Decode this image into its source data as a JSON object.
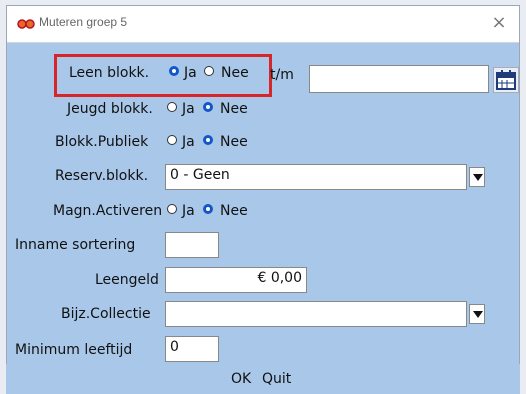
{
  "window": {
    "title": "Muteren groep 5",
    "close_glyph": "×"
  },
  "form": {
    "leen_blokk": {
      "label": "Leen blokk.",
      "options": [
        "Ja",
        "Nee"
      ],
      "selected": "Ja",
      "tm_label": "t/m",
      "tm_value": ""
    },
    "jeugd_blokk": {
      "label": "Jeugd blokk.",
      "options": [
        "Ja",
        "Nee"
      ],
      "selected": "Nee"
    },
    "blokk_publiek": {
      "label": "Blokk.Publiek",
      "options": [
        "Ja",
        "Nee"
      ],
      "selected": "Nee"
    },
    "reserv_blokk": {
      "label": "Reserv.blokk.",
      "value": "0 - Geen"
    },
    "magn_activeren": {
      "label": "Magn.Activeren",
      "options": [
        "Ja",
        "Nee"
      ],
      "selected": "Nee"
    },
    "inname_sortering": {
      "label": "Inname sortering",
      "value": ""
    },
    "leengeld": {
      "label": "Leengeld",
      "value": "€ 0,00"
    },
    "bijz_collectie": {
      "label": "Bijz.Collectie",
      "value": ""
    },
    "minimum_leeftijd": {
      "label": "Minimum leeftijd",
      "value": "0"
    }
  },
  "buttons": {
    "ok": "OK",
    "quit": "Quit"
  },
  "icons": {
    "app": "glasses-icon",
    "calendar": "calendar-icon"
  },
  "colors": {
    "dialog_bg": "#a9c8e9",
    "highlight": "#d6262a",
    "radio_selected": "#1356c8"
  }
}
